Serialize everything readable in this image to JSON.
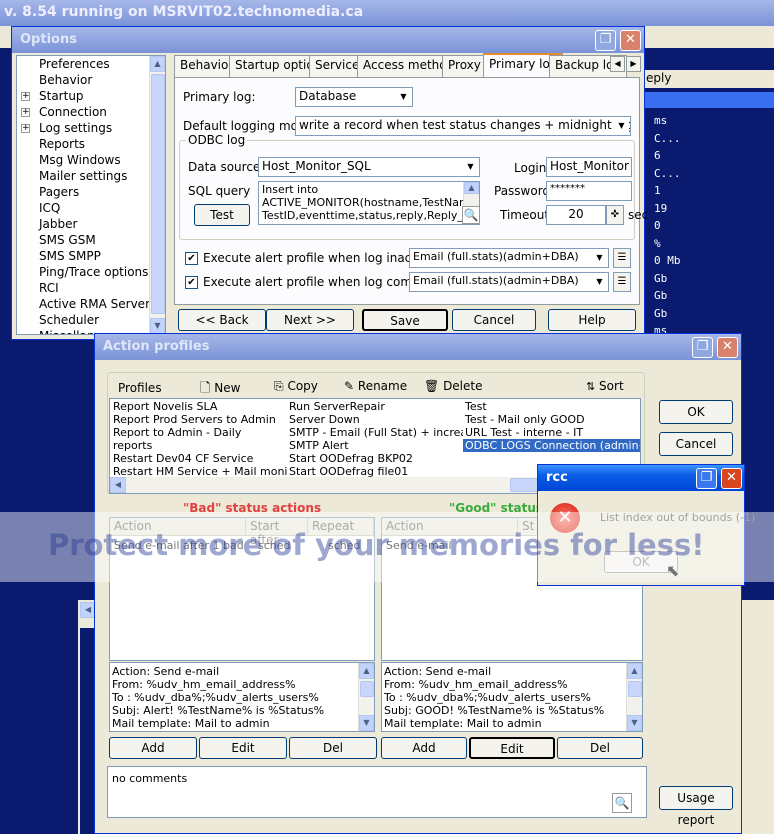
{
  "background_window": {
    "title": "v. 8.54 running on MSRVIT02.technomedia.ca",
    "reply_header": "eply",
    "reply_values": [
      "ms",
      "C...",
      "6",
      "C...",
      "1",
      "19",
      "0",
      "%",
      "0 Mb",
      "Gb",
      "Gb",
      "Gb",
      "ms"
    ]
  },
  "options": {
    "title": "Options",
    "tree": [
      {
        "label": "Preferences",
        "expandable": false
      },
      {
        "label": "Behavior",
        "expandable": false
      },
      {
        "label": "Startup",
        "expandable": true
      },
      {
        "label": "Connection",
        "expandable": true
      },
      {
        "label": "Log settings",
        "expandable": true
      },
      {
        "label": "Reports",
        "expandable": false
      },
      {
        "label": "Msg Windows",
        "expandable": false
      },
      {
        "label": "Mailer settings",
        "expandable": false
      },
      {
        "label": "Pagers",
        "expandable": false
      },
      {
        "label": "ICQ",
        "expandable": false
      },
      {
        "label": "Jabber",
        "expandable": false
      },
      {
        "label": "SMS GSM",
        "expandable": false
      },
      {
        "label": "SMS SMPP",
        "expandable": false
      },
      {
        "label": "Ping/Trace options",
        "expandable": false
      },
      {
        "label": "RCI",
        "expandable": false
      },
      {
        "label": "Active RMA Server",
        "expandable": false
      },
      {
        "label": "Scheduler",
        "expandable": false
      },
      {
        "label": "Miscellaneous",
        "expandable": false
      }
    ],
    "tabs": [
      "Behavior",
      "Startup options",
      "Service",
      "Access method",
      "Proxy",
      "Primary log",
      "Backup log"
    ],
    "active_tab": "Primary log",
    "primary_log_label": "Primary log:",
    "primary_log_value": "Database",
    "default_mode_label": "Default logging mode:",
    "default_mode_value": "write a record when test status changes + midnight logging (Midnight",
    "odbc_group": "ODBC log",
    "data_source_label": "Data source",
    "data_source_value": "Host_Monitor_SQL",
    "sql_query_label": "SQL query",
    "sql_query_lines": [
      "Insert into",
      "ACTIVE_MONITOR(hostname,TestName,",
      "TestID,eventtime,status,reply,Reply_N"
    ],
    "test_button": "Test",
    "login_label": "Login",
    "login_value": "Host_Monitor",
    "password_label": "Password",
    "password_value": "*******",
    "timeout_label": "Timeout",
    "timeout_value": "20",
    "timeout_unit": "sec",
    "exec_inaccessible_label": "Execute alert profile when log inaccessible",
    "exec_inaccessible_value": "Email (full.stats)(admin+DBA)",
    "exec_life_label": "Execute alert profile when log comes to life",
    "exec_life_value": "Email (full.stats)(admin+DBA)",
    "buttons": {
      "back": "<<  Back",
      "next": "Next  >>",
      "save": "Save",
      "cancel": "Cancel",
      "help": "Help"
    }
  },
  "action_profiles": {
    "title": "Action profiles",
    "profiles_label": "Profiles",
    "toolbar": {
      "new": "New",
      "copy": "Copy",
      "rename": "Rename",
      "delete": "Delete",
      "sort": "Sort"
    },
    "profile_columns": [
      [
        "Report Novelis SLA",
        "Report Prod Servers to Admin",
        "Report to Admin - Daily",
        "reports",
        "Restart Dev04 CF Service",
        "Restart HM Service + Mail monitoring"
      ],
      [
        "Run ServerRepair",
        "Server Down",
        "SMTP - Email (Full Stat) + increase Tr",
        "SMTP Alert",
        "Start OODefrag BKP02",
        "Start OODefrag file01"
      ],
      [
        "Test",
        "Test - Mail only GOOD",
        "URL Test - interne - IT",
        "ODBC LOGS Connection (admin+DBA)"
      ]
    ],
    "selected_profile": "ODBC LOGS Connection (admin+DBA)",
    "ok_button": "OK",
    "cancel_button": "Cancel",
    "bad": {
      "heading": "\"Bad\" status actions",
      "columns": [
        "Action",
        "Start after",
        "Repeat"
      ],
      "rows": [
        {
          "action": "Send e-mail after 1 bad",
          "start": "sched",
          "repeat": "sched"
        }
      ],
      "details": [
        "Action: Send e-mail",
        "From: %udv_hm_email_address%",
        "To  : %udv_dba%;%udv_alerts_users%",
        "Subj: Alert! %TestName%  is %Status%",
        "Mail template: Mail to admin"
      ]
    },
    "good": {
      "heading": "\"Good\" status a",
      "columns": [
        "Action",
        "St"
      ],
      "rows": [
        {
          "action": "Send e-mail"
        }
      ],
      "details": [
        "Action: Send e-mail",
        "From: %udv_hm_email_address%",
        "To  : %udv_dba%;%udv_alerts_users%",
        "Subj: GOOD! %TestName%  is %Status%",
        "Mail template: Mail to admin"
      ]
    },
    "action_buttons": {
      "add": "Add",
      "edit": "Edit",
      "del": "Del"
    },
    "comments": "no comments",
    "usage_report": "Usage report"
  },
  "error_dialog": {
    "title": "rcc",
    "message": "List index out of bounds (-1)",
    "ok": "OK"
  },
  "watermark": "Protect more of your memories for less!"
}
